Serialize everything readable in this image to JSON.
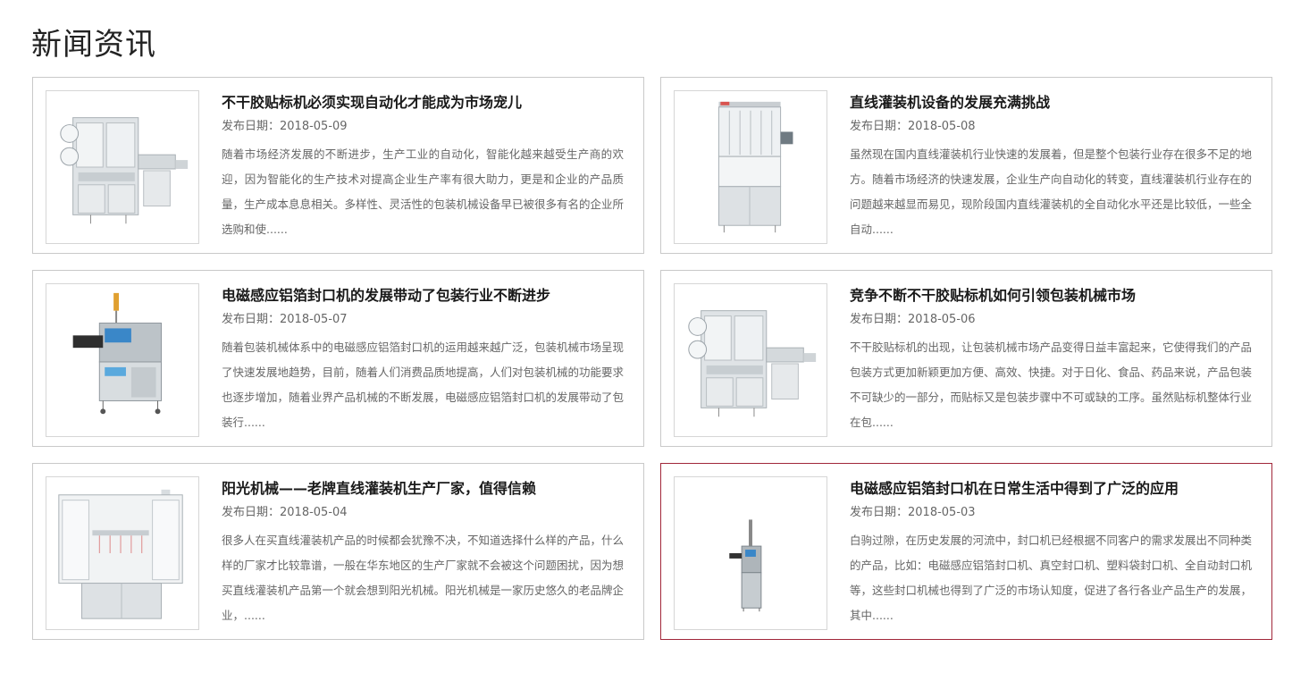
{
  "section": {
    "title": "新闻资讯"
  },
  "date_prefix": "发布日期：",
  "articles": [
    {
      "title": "不干胶贴标机必须实现自动化才能成为市场宠儿",
      "date": "发布日期：2018-05-09",
      "summary": "随着市场经济发展的不断进步，生产工业的自动化，智能化越来越受生产商的欢迎，因为智能化的生产技术对提高企业生产率有很大助力，更是和企业的产品质量，生产成本息息相关。多样性、灵活性的包装机械设备早已被很多有名的企业所选购和使......",
      "image": "labeling-machine"
    },
    {
      "title": "直线灌装机设备的发展充满挑战",
      "date": "发布日期：2018-05-08",
      "summary": "虽然现在国内直线灌装机行业快速的发展着，但是整个包装行业存在很多不足的地方。随着市场经济的快速发展，企业生产向自动化的转变，直线灌装机行业存在的问题越来越显而易见，现阶段国内直线灌装机的全自动化水平还是比较低，一些全自动......",
      "image": "filling-machine"
    },
    {
      "title": "电磁感应铝箔封口机的发展带动了包装行业不断进步",
      "date": "发布日期：2018-05-07",
      "summary": "随着包装机械体系中的电磁感应铝箔封口机的运用越来越广泛，包装机械市场呈现了快速发展地趋势，目前，随着人们消费品质地提高，人们对包装机械的功能要求也逐步增加，随着业界产品机械的不断发展，电磁感应铝箔封口机的发展带动了包装行......",
      "image": "sealing-machine"
    },
    {
      "title": "竞争不断不干胶贴标机如何引领包装机械市场",
      "date": "发布日期：2018-05-06",
      "summary": "不干胶贴标机的出现，让包装机械市场产品变得日益丰富起来，它使得我们的产品包装方式更加新颖更加方便、高效、快捷。对于日化、食品、药品来说，产品包装不可缺少的一部分，而贴标又是包装步骤中不可或缺的工序。虽然贴标机整体行业在包......",
      "image": "labeling-machine"
    },
    {
      "title": "阳光机械——老牌直线灌装机生产厂家，值得信赖",
      "date": "发布日期：2018-05-04",
      "summary": "很多人在买直线灌装机产品的时候都会犹豫不决，不知道选择什么样的产品，什么样的厂家才比较靠谱，一般在华东地区的生产厂家就不会被这个问题困扰，因为想买直线灌装机产品第一个就会想到阳光机械。阳光机械是一家历史悠久的老品牌企业，......",
      "image": "filling-cabinet"
    },
    {
      "title": "电磁感应铝箔封口机在日常生活中得到了广泛的应用",
      "date": "发布日期：2018-05-03",
      "summary": "白驹过隙，在历史发展的河流中，封口机已经根据不同客户的需求发展出不同种类的产品，比如：电磁感应铝箔封口机、真空封口机、塑料袋封口机、全自动封口机等，这些封口机械也得到了广泛的市场认知度，促进了各行各业产品生产的发展，其中......",
      "image": "sealing-small"
    }
  ]
}
